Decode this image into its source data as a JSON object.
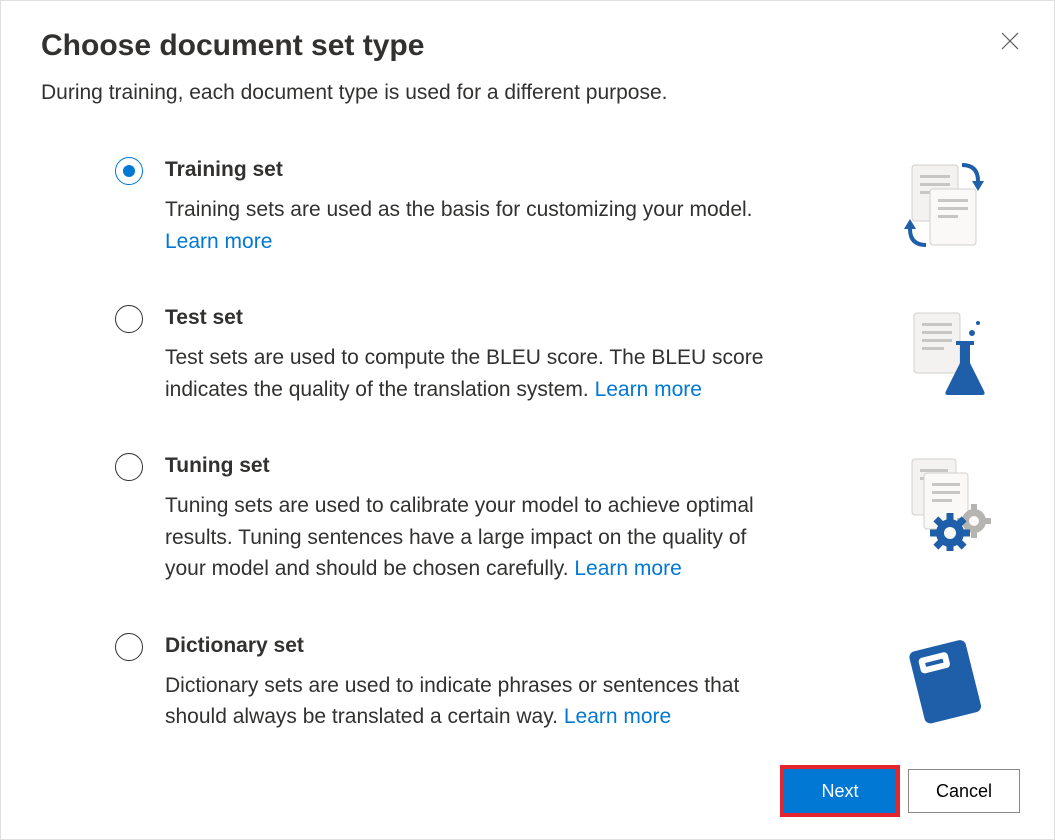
{
  "dialog": {
    "title": "Choose document set type",
    "subtitle": "During training, each document type is used for a different purpose.",
    "learn_more_label": "Learn more",
    "options": [
      {
        "id": "training",
        "label": "Training set",
        "description": "Training sets are used as the basis for customizing your model.",
        "selected": true,
        "icon": "doc-exchange-icon"
      },
      {
        "id": "test",
        "label": "Test set",
        "description": "Test sets are used to compute the BLEU score. The BLEU score indicates the quality of the translation system.",
        "selected": false,
        "icon": "doc-flask-icon"
      },
      {
        "id": "tuning",
        "label": "Tuning set",
        "description": "Tuning sets are used to calibrate your model to achieve optimal results. Tuning sentences have a large impact on the quality of your model and should be chosen carefully.",
        "selected": false,
        "icon": "doc-gear-icon"
      },
      {
        "id": "dictionary",
        "label": "Dictionary set",
        "description": "Dictionary sets are used to indicate phrases or sentences that should always be translated a certain way.",
        "selected": false,
        "icon": "notebook-icon"
      }
    ],
    "footer": {
      "next_label": "Next",
      "cancel_label": "Cancel"
    }
  }
}
